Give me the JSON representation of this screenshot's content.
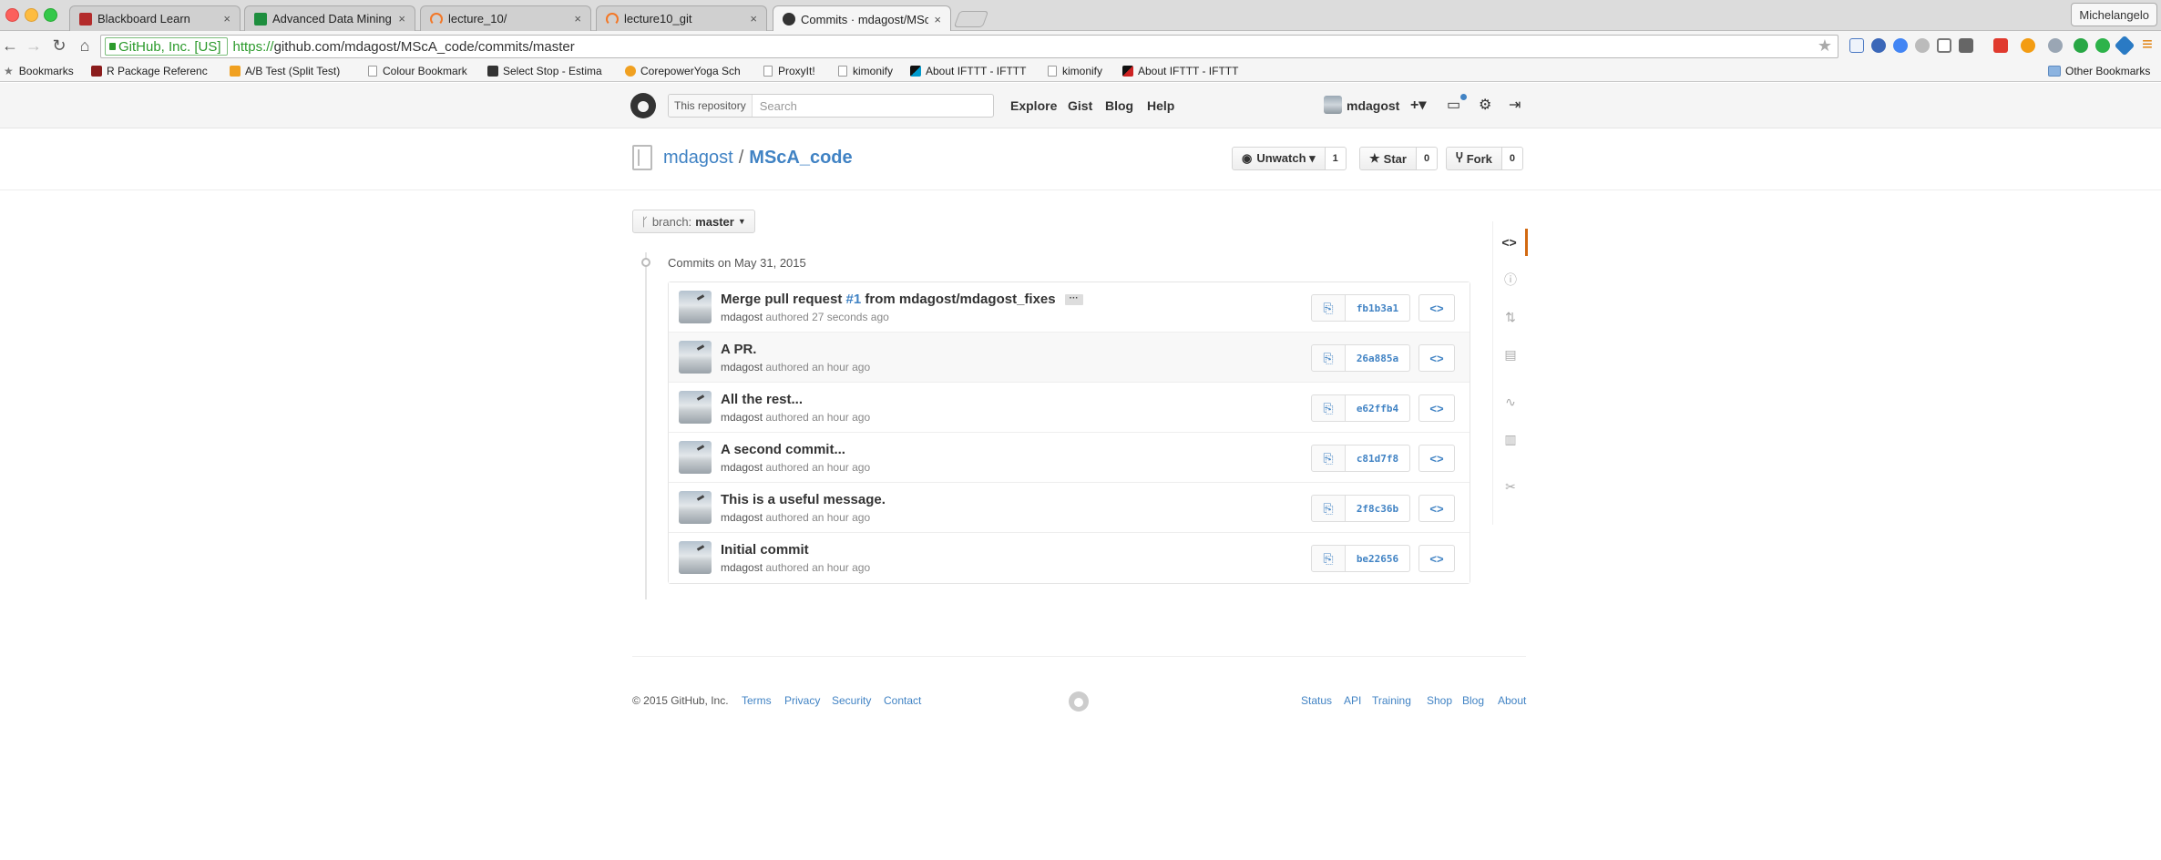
{
  "browser": {
    "tabs": [
      {
        "title": "Blackboard Learn",
        "favicon_color": "#b32b2b"
      },
      {
        "title": "Advanced Data Mining and",
        "favicon_color": "#1e8e3e"
      },
      {
        "title": "lecture_10/",
        "favicon_color": "#f37726"
      },
      {
        "title": "lecture10_git",
        "favicon_color": "#f37726"
      },
      {
        "title": "Commits · mdagost/MScA",
        "favicon_color": "#333333"
      }
    ],
    "tab_close": "×",
    "profile_name": "Michelangelo",
    "ev_badge": "GitHub, Inc. [US]",
    "url_scheme": "https://",
    "url_host": "github.com",
    "url_path": "/mdagost/MScA_code/commits/master",
    "bookmarks": [
      {
        "label": "Bookmarks"
      },
      {
        "label": "R Package Referenc"
      },
      {
        "label": "A/B Test (Split Test)"
      },
      {
        "label": "Colour Bookmark"
      },
      {
        "label": "Select Stop - Estima"
      },
      {
        "label": "CorepowerYoga Sch"
      },
      {
        "label": "ProxyIt!"
      },
      {
        "label": "kimonify"
      },
      {
        "label": "About IFTTT - IFTTT"
      },
      {
        "label": "kimonify"
      },
      {
        "label": "About IFTTT - IFTTT"
      },
      {
        "label": "Other Bookmarks"
      }
    ]
  },
  "github_header": {
    "search_scope": "This repository",
    "search_placeholder": "Search",
    "nav": [
      "Explore",
      "Gist",
      "Blog",
      "Help"
    ],
    "username": "mdagost",
    "plus_label": "+▾"
  },
  "repo": {
    "owner": "mdagost",
    "separator": "/",
    "name": "MScA_code",
    "unwatch_label": "Unwatch ▾",
    "watch_count": "1",
    "star_label": "Star",
    "star_count": "0",
    "fork_label": "Fork",
    "fork_count": "0"
  },
  "branch": {
    "label": "branch:",
    "name": "master"
  },
  "commits_date": "Commits on May 31, 2015",
  "commits": [
    {
      "title_prefix": "Merge pull request ",
      "pr": "#1",
      "title_suffix": " from mdagost/mdagost_fixes",
      "has_ellipsis": true,
      "author": "mdagost",
      "when": " authored 27 seconds ago",
      "sha": "fb1b3a1"
    },
    {
      "title_prefix": "A PR.",
      "pr": "",
      "title_suffix": "",
      "has_ellipsis": false,
      "author": "mdagost",
      "when": " authored an hour ago",
      "sha": "26a885a"
    },
    {
      "title_prefix": "All the rest...",
      "pr": "",
      "title_suffix": "",
      "has_ellipsis": false,
      "author": "mdagost",
      "when": " authored an hour ago",
      "sha": "e62ffb4"
    },
    {
      "title_prefix": "A second commit...",
      "pr": "",
      "title_suffix": "",
      "has_ellipsis": false,
      "author": "mdagost",
      "when": " authored an hour ago",
      "sha": "c81d7f8"
    },
    {
      "title_prefix": "This is a useful message.",
      "pr": "",
      "title_suffix": "",
      "has_ellipsis": false,
      "author": "mdagost",
      "when": " authored an hour ago",
      "sha": "2f8c36b"
    },
    {
      "title_prefix": "Initial commit",
      "pr": "",
      "title_suffix": "",
      "has_ellipsis": false,
      "author": "mdagost",
      "when": " authored an hour ago",
      "sha": "be22656"
    }
  ],
  "ellipsis_label": "···",
  "browse_label": "<>",
  "copy_icon": "⎘",
  "sidebar_icons": [
    "code-icon",
    "issues-icon",
    "pull-requests-icon",
    "wiki-icon",
    "pulse-icon",
    "graphs-icon",
    "settings-icon"
  ],
  "footer": {
    "copyright": "© 2015 GitHub, Inc.",
    "left_links": [
      "Terms",
      "Privacy",
      "Security",
      "Contact"
    ],
    "right_links": [
      "Status",
      "API",
      "Training",
      "Shop",
      "Blog",
      "About"
    ]
  }
}
